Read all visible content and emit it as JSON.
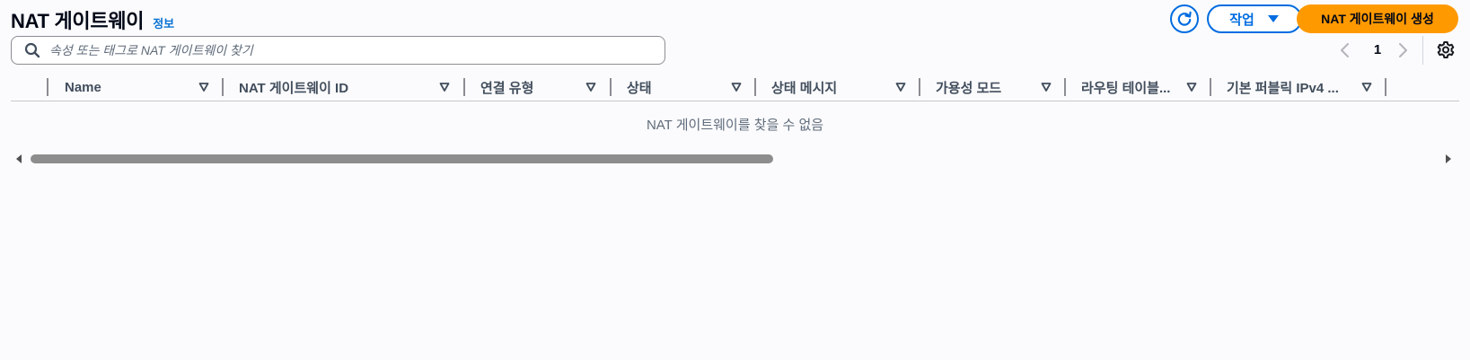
{
  "header": {
    "title": "NAT 게이트웨이",
    "info_link": "정보",
    "actions_label": "작업",
    "create_label": "NAT 게이트웨이 생성"
  },
  "search": {
    "placeholder": "속성 또는 태그로 NAT 게이트웨이 찾기"
  },
  "pagination": {
    "current_page": "1"
  },
  "table": {
    "columns": [
      "Name",
      "NAT 게이트웨이 ID",
      "연결 유형",
      "상태",
      "상태 메시지",
      "가용성 모드",
      "라우팅 테이블...",
      "기본 퍼블릭 IPv4 ..."
    ],
    "empty_message": "NAT 게이트웨이를 찾을 수 없음"
  },
  "scrollbar": {
    "visible_fraction": 0.54
  },
  "colors": {
    "primary": "#006ce0",
    "link": "#0972d3",
    "create_button": "#ff9900",
    "header_text": "#414d5c",
    "empty_text": "#5f6b7a"
  },
  "icons": {
    "refresh": "refresh-icon",
    "dropdown": "caret-down-icon",
    "search": "search-icon",
    "prev": "chevron-left-icon",
    "next": "chevron-right-icon",
    "settings": "gear-icon",
    "sort": "sort-triangle-icon"
  }
}
